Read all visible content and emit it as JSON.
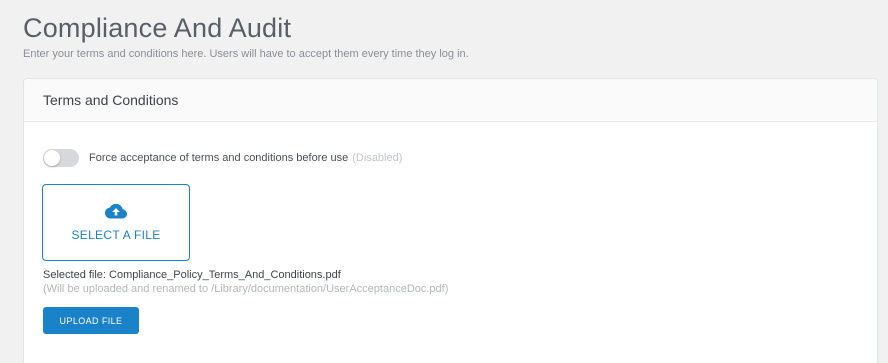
{
  "page": {
    "title": "Compliance And Audit",
    "subtitle": "Enter your terms and conditions here. Users will have to accept them every time they log in."
  },
  "card": {
    "title": "Terms and Conditions",
    "toggle": {
      "label": "Force acceptance of terms and conditions before use",
      "state_text": "(Disabled)",
      "enabled": false
    },
    "file_select": {
      "icon": "cloud-upload-icon",
      "label": "SELECT A FILE"
    },
    "selected_file": "Selected file: Compliance_Policy_Terms_And_Conditions.pdf",
    "upload_note": "(Will be uploaded and renamed to /Library/documentation/UserAcceptanceDoc.pdf)",
    "upload_button": "UPLOAD FILE"
  },
  "colors": {
    "accent": "#1a82c9",
    "toggle_off": "#d6d8db",
    "background": "#f1f1f2"
  }
}
